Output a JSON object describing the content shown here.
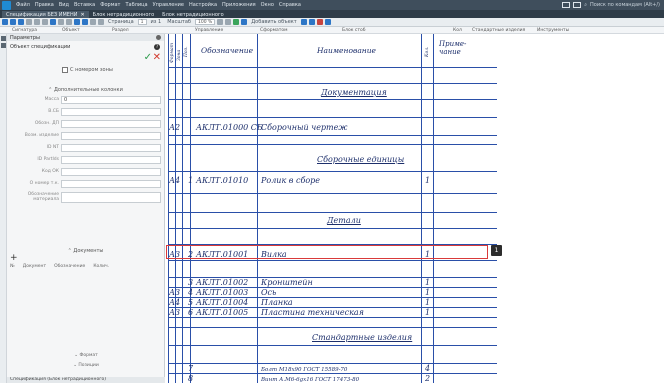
{
  "menubar": {
    "items": [
      "Файл",
      "Правка",
      "Вид",
      "Вставка",
      "Формат",
      "Таблица",
      "Управление",
      "Настройка",
      "Приложения",
      "Окно",
      "Справка"
    ],
    "search_placeholder": "Поиск по командам (Alt+/)"
  },
  "tabs": [
    {
      "label": "Спецификация БЕЗ ИМЕНИ",
      "active": true
    },
    {
      "label": "Блок нетрадиционного"
    },
    {
      "label": "Блок нетрадиционного"
    }
  ],
  "toolbar": {
    "page_label": "Страница",
    "page_value": "1",
    "page_of": "из 1",
    "scale_label": "Масштаб",
    "scale_value": "100 %",
    "add_label": "Добавить\nобъект"
  },
  "column_header": {
    "cols": [
      "Сигнатура",
      "Объект",
      "Раздел",
      "Управление",
      "Сформатом",
      "Блок стоб",
      "Кол",
      "Стандартные изделия",
      "Инструменты"
    ]
  },
  "left_panel": {
    "title": "Параметры",
    "spec_label": "Объект спецификации",
    "checkbox_label": "С номером зоны",
    "section_head": "Дополнительные колонки",
    "fields": [
      {
        "label": "Масса",
        "value": "0"
      },
      {
        "label": "В.СБ",
        "value": ""
      },
      {
        "label": "Обозн. ДП",
        "value": ""
      },
      {
        "label": "Возм. изделие",
        "value": ""
      },
      {
        "label": "ID NT",
        "value": ""
      },
      {
        "label": "ID PartIds",
        "value": ""
      },
      {
        "label": "Код ОК",
        "value": ""
      },
      {
        "label": "О номер т.к.",
        "value": ""
      },
      {
        "label": "Обозначение материала",
        "value": ""
      }
    ],
    "docs_head": "Документы",
    "docs_cols": [
      "№",
      "Документ",
      "Обозначение",
      "Колич."
    ],
    "collapse_items": [
      "Формат",
      "Позиции"
    ],
    "bottom_label": "Спецификация (Блок нетрадиционного)"
  },
  "spec_table": {
    "headers": {
      "format": "Формат",
      "zone": "Зона",
      "pos": "Поз.",
      "designation": "Обозначение",
      "name": "Наименование",
      "qty": "Кол.",
      "note": "Приме-\nчание"
    },
    "rows": [
      {
        "type": "section",
        "name": "Документация"
      },
      {
        "format": "А2",
        "pos": "",
        "designation": "АКЛТ.01000 СБ",
        "name": "Сборочный чертеж",
        "qty": ""
      },
      {
        "type": "section",
        "name": "Сборочные единицы"
      },
      {
        "format": "А4",
        "pos": "1",
        "designation": "АКЛТ.01010",
        "name": "Ролик в сборе",
        "qty": "1"
      },
      {
        "type": "section",
        "name": "Детали"
      },
      {
        "format": "А3",
        "pos": "2",
        "designation": "АКЛТ.01001",
        "name": "Вилка",
        "qty": "1"
      },
      {
        "type": "empty"
      },
      {
        "format": "",
        "pos": "3",
        "designation": "АКЛТ.01002",
        "name": "Кронштейн",
        "qty": "1"
      },
      {
        "format": "А3",
        "pos": "4",
        "designation": "АКЛТ.01003",
        "name": "Ось",
        "qty": "1"
      },
      {
        "format": "А4",
        "pos": "5",
        "designation": "АКЛТ.01004",
        "name": "Планка",
        "qty": "1"
      },
      {
        "format": "А3",
        "pos": "6",
        "designation": "АКЛТ.01005",
        "name": "Пластина техническая",
        "qty": "1"
      },
      {
        "type": "section",
        "name": "Стандартные изделия"
      },
      {
        "format": "",
        "pos": "7",
        "designation": "",
        "name": "Болт М18х90 ГОСТ 15589-70",
        "qty": "4"
      },
      {
        "format": "",
        "pos": "8",
        "designation": "",
        "name": "Винт А.М6-6gх16 ГОСТ 17473-80",
        "qty": "2"
      }
    ]
  },
  "selection_marker": "1",
  "colors": {
    "accent": "#2a4fa8",
    "selection": "#d93a3a"
  }
}
